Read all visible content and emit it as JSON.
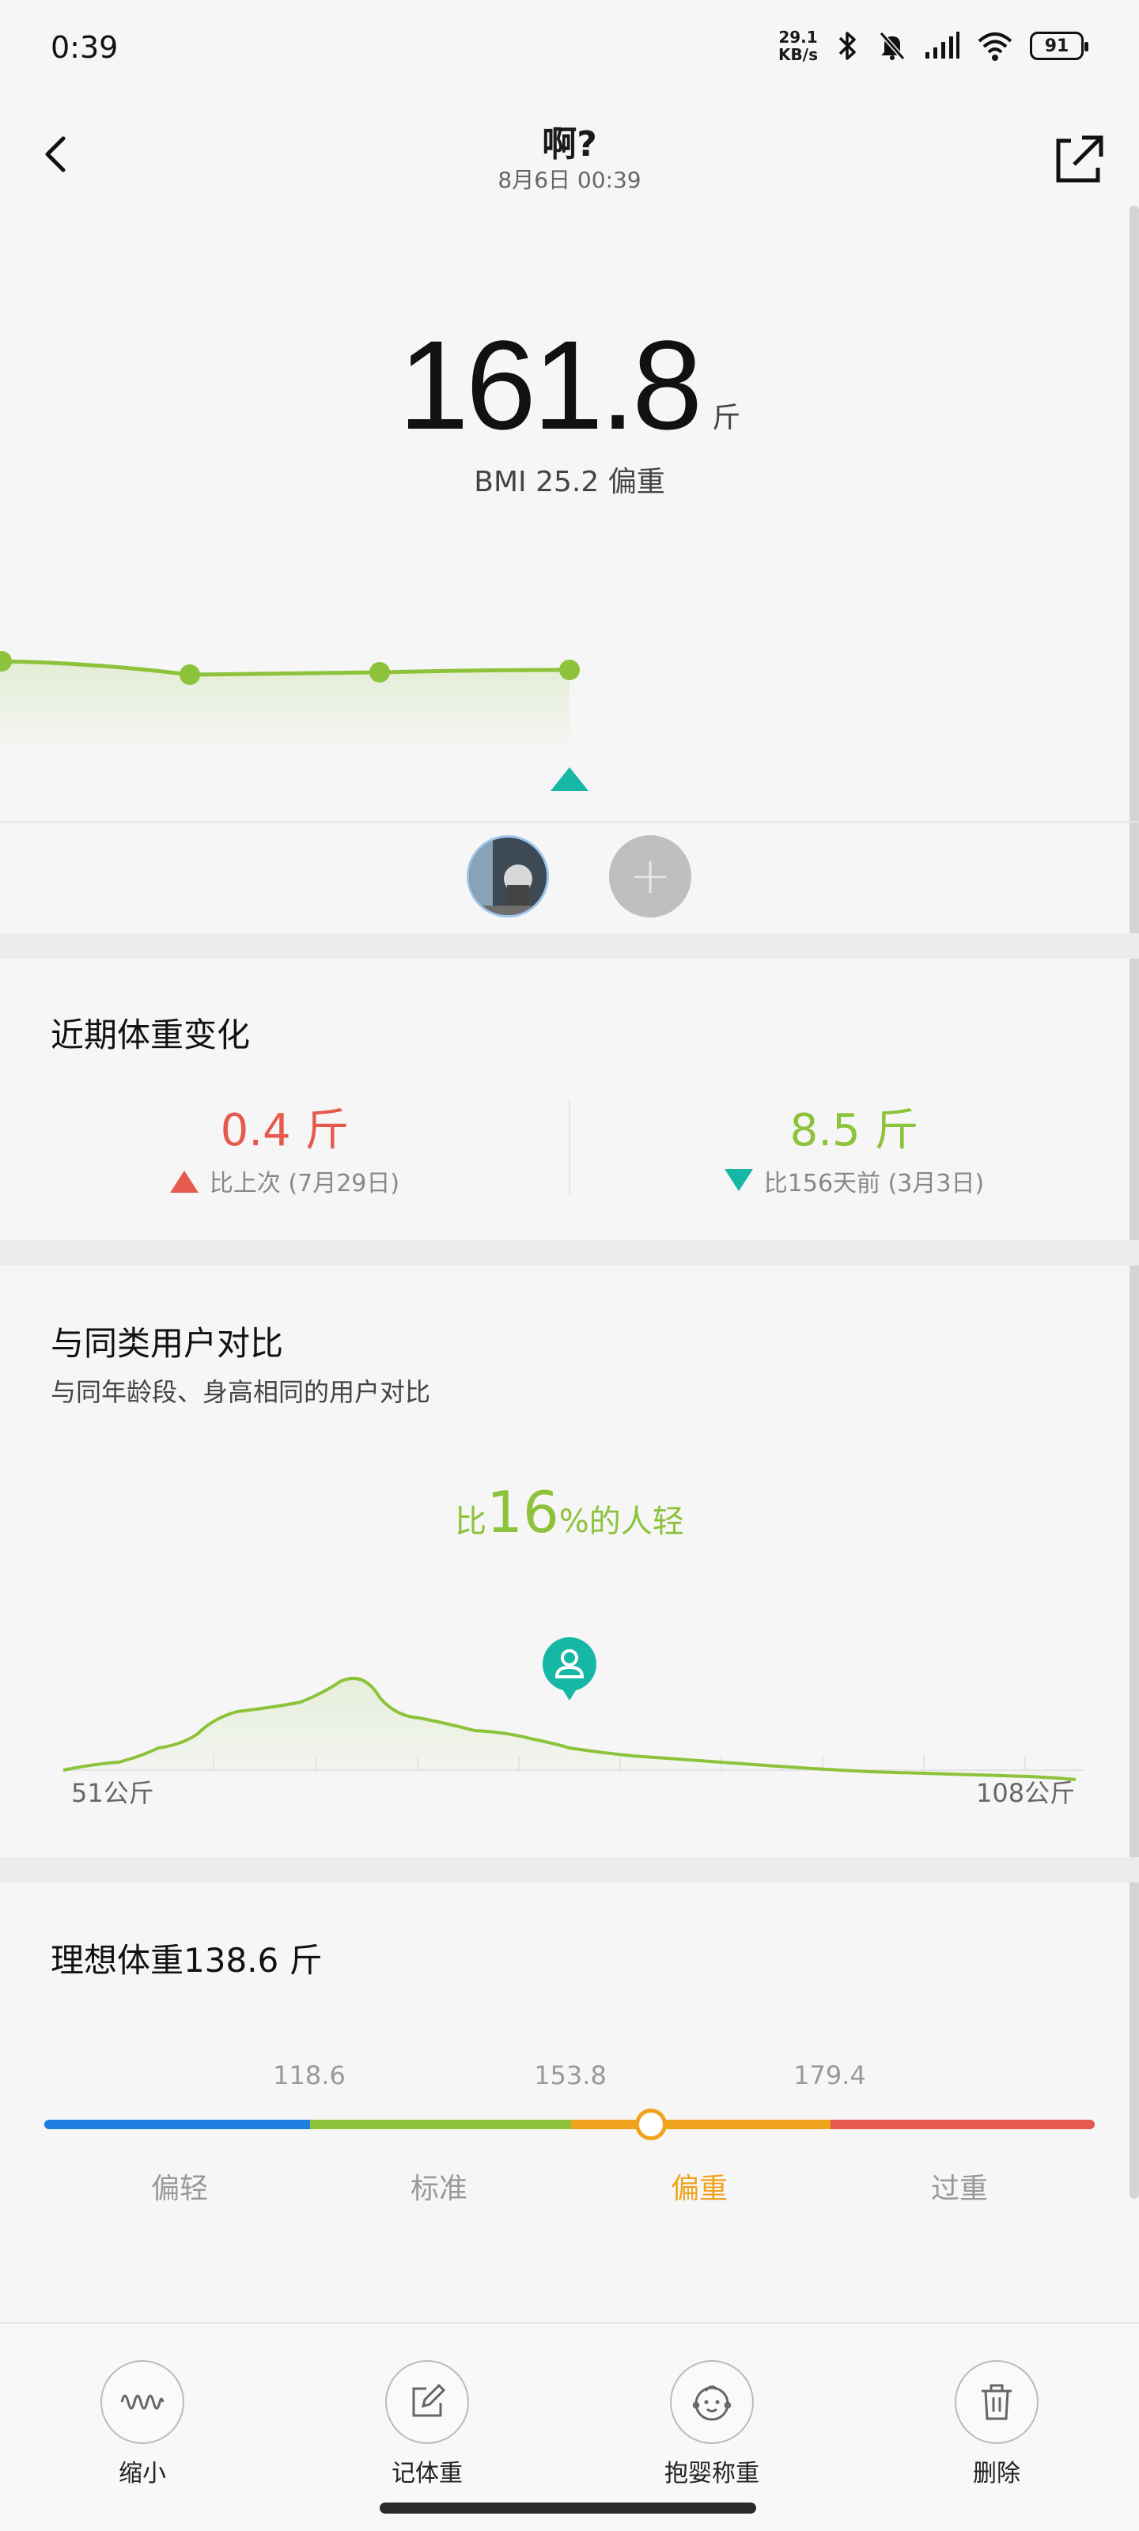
{
  "status_bar": {
    "time": "0:39",
    "net_speed_value": "29.1",
    "net_speed_unit": "KB/s",
    "battery": "91",
    "icons": [
      "bluetooth-icon",
      "mute-icon",
      "signal-icon",
      "wifi-icon",
      "battery-icon"
    ]
  },
  "header": {
    "title": "啊?",
    "subtitle": "8月6日 00:39"
  },
  "weight": {
    "value": "161.8",
    "unit": "斤",
    "bmi": "BMI 25.2  偏重"
  },
  "recent_change": {
    "title": "近期体重变化",
    "previous": {
      "value": "0.4 斤",
      "desc": "比上次 (7月29日)",
      "direction": "up",
      "color": "#e65a4d"
    },
    "long_term": {
      "value": "8.5 斤",
      "desc": "比156天前 (3月3日)",
      "direction": "down",
      "color": "#8cc33a"
    }
  },
  "comparison": {
    "title": "与同类用户对比",
    "subtitle": "与同年龄段、身高相同的用户对比",
    "headline_prefix": "比",
    "headline_percent": "16",
    "headline_suffix": "%的人轻",
    "min_label": "51公斤",
    "max_label": "108公斤"
  },
  "ideal_weight": {
    "title": "理想体重138.6 斤",
    "thresholds": [
      "118.6",
      "153.8",
      "179.4"
    ],
    "categories": [
      "偏轻",
      "标准",
      "偏重",
      "过重"
    ],
    "active_category": "偏重",
    "colors": [
      "#1f7fe0",
      "#8cc33a",
      "#f0a31d",
      "#e65a4d"
    ]
  },
  "bottom_bar": {
    "shrink": "缩小",
    "record": "记体重",
    "baby": "抱婴称重",
    "delete": "删除"
  },
  "colors": {
    "accent_green": "#8cc33a",
    "teal": "#17b7a5",
    "red": "#e65a4d",
    "orange": "#f0a31d"
  }
}
